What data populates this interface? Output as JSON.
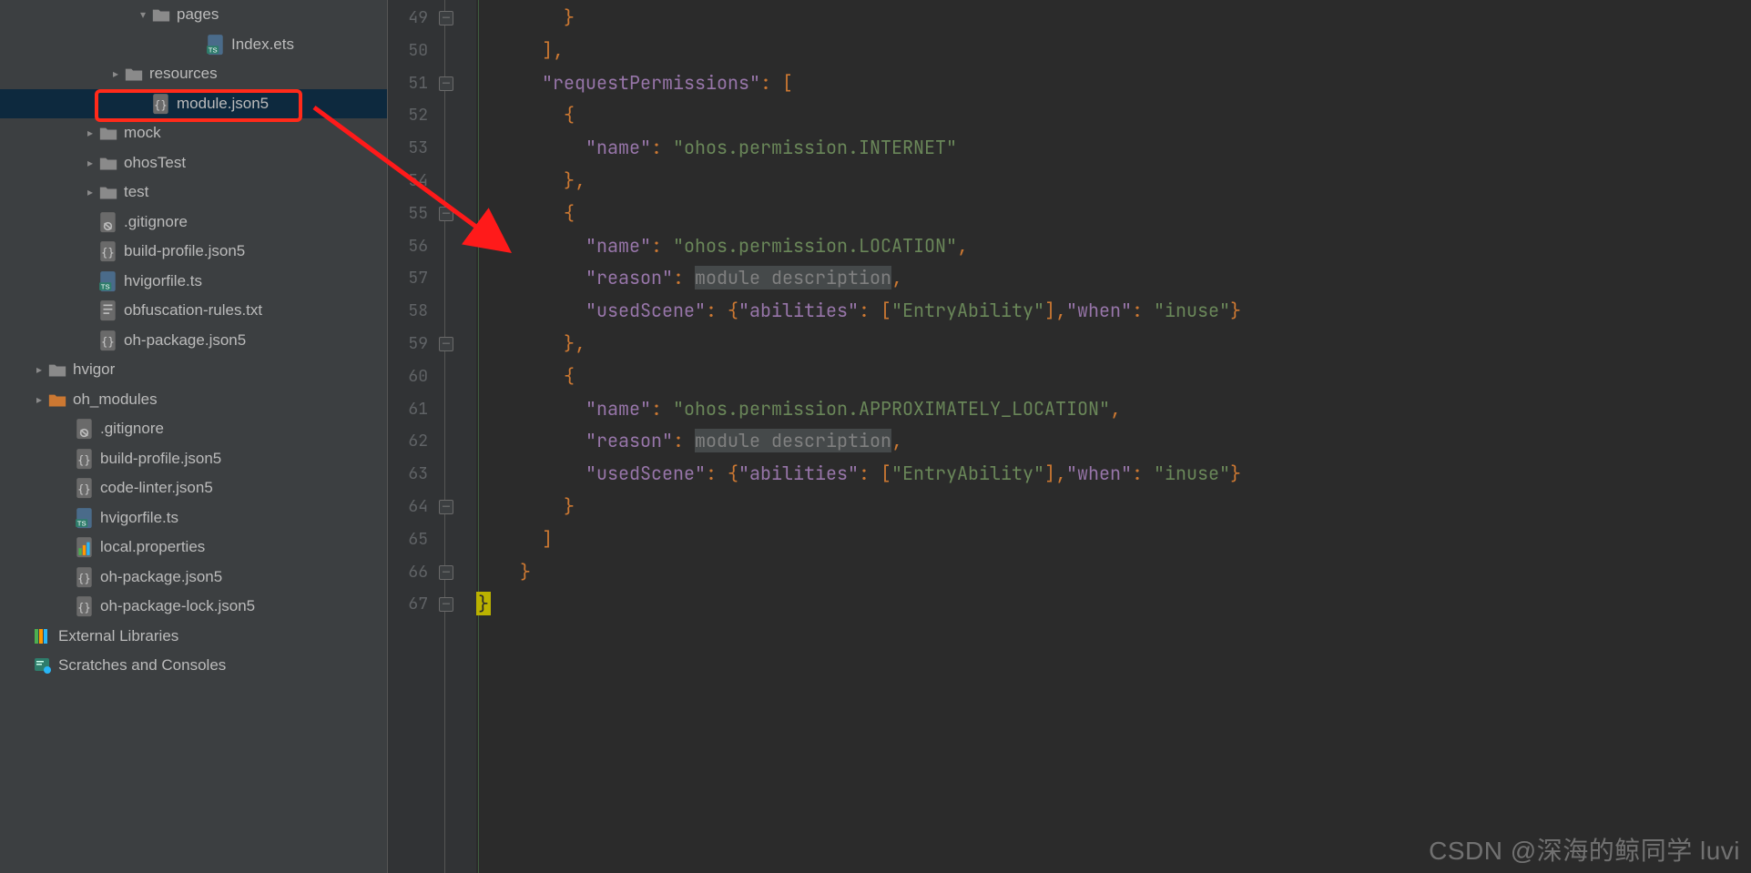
{
  "tree": {
    "rows": [
      {
        "indent": 130,
        "chev": "v",
        "icon": "folder",
        "label": "pages"
      },
      {
        "indent": 190,
        "chev": "",
        "icon": "ets",
        "label": "Index.ets"
      },
      {
        "indent": 100,
        "chev": ">",
        "icon": "folder",
        "label": "resources"
      },
      {
        "indent": 130,
        "chev": "",
        "icon": "json5",
        "label": "module.json5",
        "selected": true
      },
      {
        "indent": 72,
        "chev": ">",
        "icon": "folder",
        "label": "mock"
      },
      {
        "indent": 72,
        "chev": ">",
        "icon": "folder",
        "label": "ohosTest"
      },
      {
        "indent": 72,
        "chev": ">",
        "icon": "folder",
        "label": "test"
      },
      {
        "indent": 72,
        "chev": "",
        "icon": "git",
        "label": ".gitignore"
      },
      {
        "indent": 72,
        "chev": "",
        "icon": "json5",
        "label": "build-profile.json5"
      },
      {
        "indent": 72,
        "chev": "",
        "icon": "ts",
        "label": "hvigorfile.ts"
      },
      {
        "indent": 72,
        "chev": "",
        "icon": "txt",
        "label": "obfuscation-rules.txt"
      },
      {
        "indent": 72,
        "chev": "",
        "icon": "json5",
        "label": "oh-package.json5"
      },
      {
        "indent": 16,
        "chev": ">",
        "icon": "folder",
        "label": "hvigor"
      },
      {
        "indent": 16,
        "chev": ">",
        "icon": "folder-o",
        "label": "oh_modules"
      },
      {
        "indent": 46,
        "chev": "",
        "icon": "git",
        "label": ".gitignore"
      },
      {
        "indent": 46,
        "chev": "",
        "icon": "json5",
        "label": "build-profile.json5"
      },
      {
        "indent": 46,
        "chev": "",
        "icon": "json5",
        "label": "code-linter.json5"
      },
      {
        "indent": 46,
        "chev": "",
        "icon": "ts",
        "label": "hvigorfile.ts"
      },
      {
        "indent": 46,
        "chev": "",
        "icon": "prop",
        "label": "local.properties"
      },
      {
        "indent": 46,
        "chev": "",
        "icon": "json5",
        "label": "oh-package.json5"
      },
      {
        "indent": 46,
        "chev": "",
        "icon": "json5",
        "label": "oh-package-lock.json5"
      },
      {
        "indent": 0,
        "chev": "",
        "icon": "lib",
        "label": "External Libraries"
      },
      {
        "indent": 0,
        "chev": "",
        "icon": "scr",
        "label": "Scratches and Consoles"
      }
    ]
  },
  "editor": {
    "first_line": 49,
    "fold_minus_at": [
      49,
      51,
      55,
      59,
      64,
      66,
      67
    ],
    "code": [
      [
        [
          "p",
          "        }"
        ]
      ],
      [
        [
          "p",
          "      ],"
        ]
      ],
      [
        [
          "p",
          "      "
        ],
        [
          "k",
          "\"requestPermissions\""
        ],
        [
          "p",
          ": ["
        ]
      ],
      [
        [
          "p",
          "        {"
        ]
      ],
      [
        [
          "p",
          "          "
        ],
        [
          "k",
          "\"name\""
        ],
        [
          "p",
          ": "
        ],
        [
          "s",
          "\"ohos.permission.INTERNET\""
        ]
      ],
      [
        [
          "p",
          "        },"
        ]
      ],
      [
        [
          "p",
          "        {"
        ]
      ],
      [
        [
          "p",
          "          "
        ],
        [
          "k",
          "\"name\""
        ],
        [
          "p",
          ": "
        ],
        [
          "s",
          "\"ohos.permission.LOCATION\""
        ],
        [
          "p",
          ","
        ]
      ],
      [
        [
          "p",
          "          "
        ],
        [
          "k",
          "\"reason\""
        ],
        [
          "p",
          ": "
        ],
        [
          "dim",
          "module description"
        ],
        [
          "p",
          ","
        ]
      ],
      [
        [
          "p",
          "          "
        ],
        [
          "k",
          "\"usedScene\""
        ],
        [
          "p",
          ": {"
        ],
        [
          "k",
          "\"abilities\""
        ],
        [
          "p",
          ": ["
        ],
        [
          "s",
          "\"EntryAbility\""
        ],
        [
          "p",
          "],"
        ],
        [
          "k",
          "\"when\""
        ],
        [
          "p",
          ": "
        ],
        [
          "s",
          "\"inuse\""
        ],
        [
          "p",
          "}"
        ]
      ],
      [
        [
          "p",
          "        },"
        ]
      ],
      [
        [
          "p",
          "        {"
        ]
      ],
      [
        [
          "p",
          "          "
        ],
        [
          "k",
          "\"name\""
        ],
        [
          "p",
          ": "
        ],
        [
          "s",
          "\"ohos.permission.APPROXIMATELY_LOCATION\""
        ],
        [
          "p",
          ","
        ]
      ],
      [
        [
          "p",
          "          "
        ],
        [
          "k",
          "\"reason\""
        ],
        [
          "p",
          ": "
        ],
        [
          "dim",
          "module description"
        ],
        [
          "p",
          ","
        ]
      ],
      [
        [
          "p",
          "          "
        ],
        [
          "k",
          "\"usedScene\""
        ],
        [
          "p",
          ": {"
        ],
        [
          "k",
          "\"abilities\""
        ],
        [
          "p",
          ": ["
        ],
        [
          "s",
          "\"EntryAbility\""
        ],
        [
          "p",
          "],"
        ],
        [
          "k",
          "\"when\""
        ],
        [
          "p",
          ": "
        ],
        [
          "s",
          "\"inuse\""
        ],
        [
          "p",
          "}"
        ]
      ],
      [
        [
          "p",
          "        }"
        ]
      ],
      [
        [
          "p",
          "      ]"
        ]
      ],
      [
        [
          "p",
          "    }"
        ]
      ],
      [
        [
          "caret",
          "}"
        ]
      ]
    ]
  },
  "watermark": "CSDN @深海的鲸同学 luvi"
}
